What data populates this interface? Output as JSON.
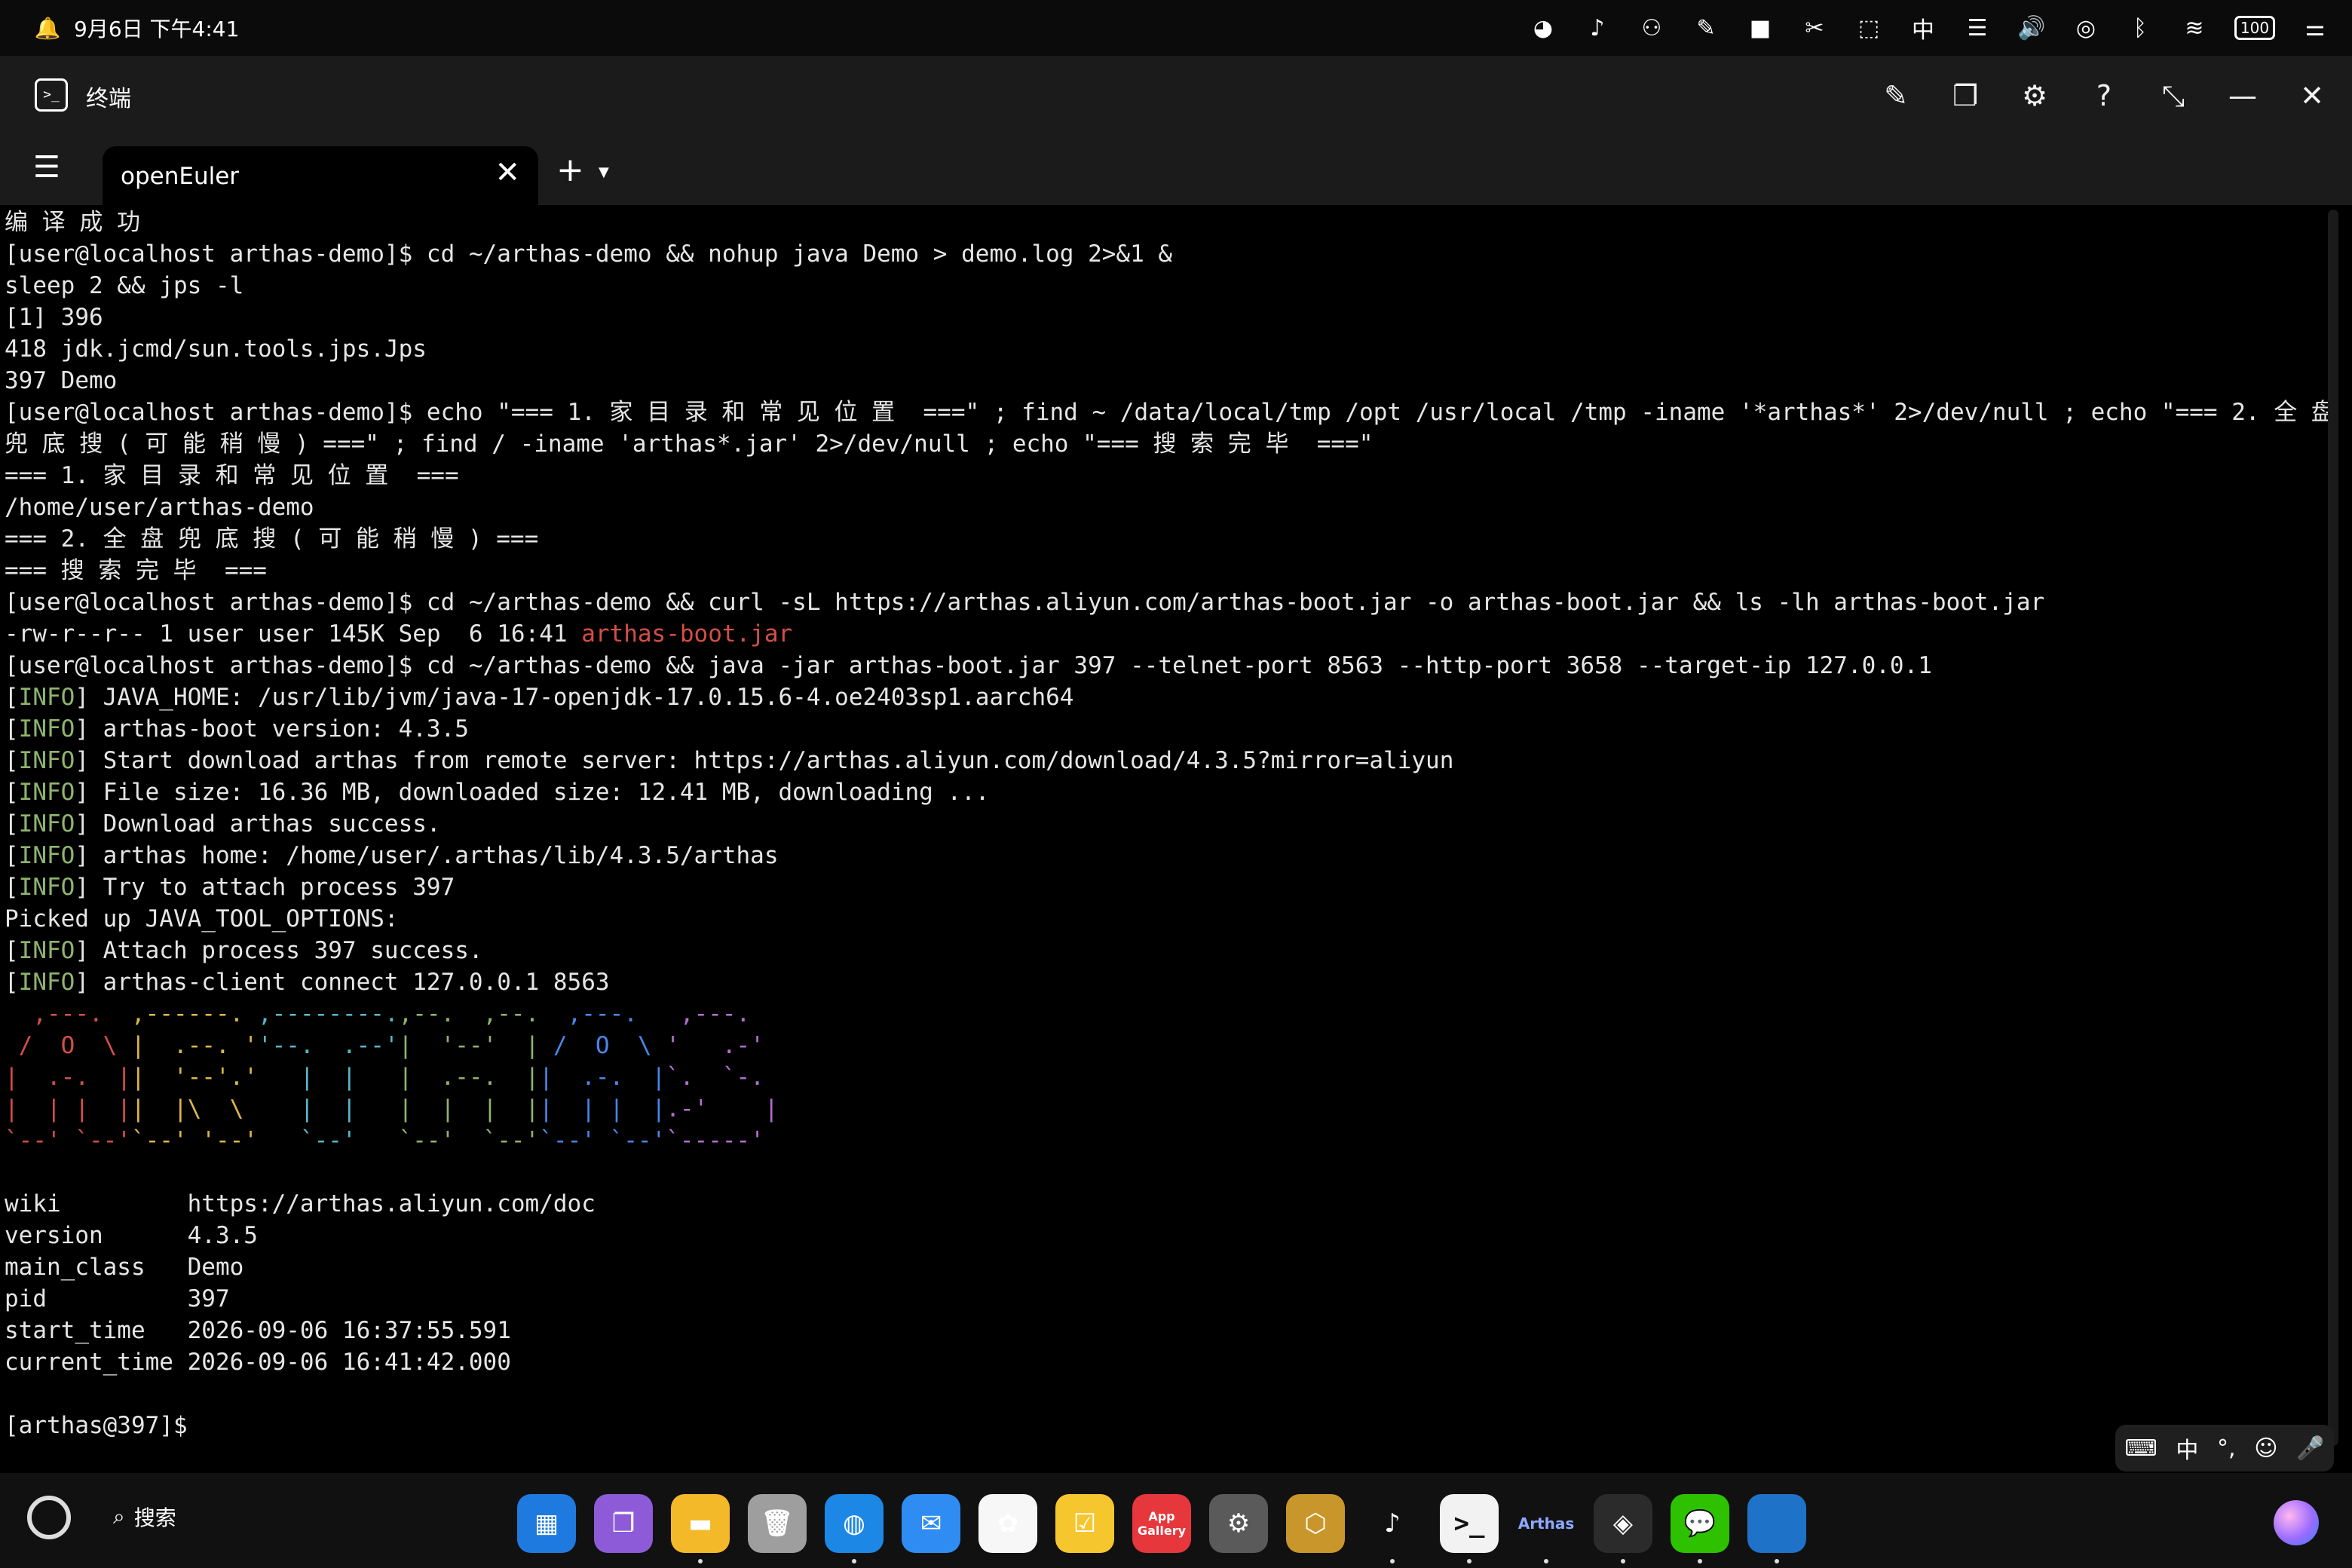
{
  "status_bar": {
    "datetime": "9月6日 下午4:41",
    "icons": [
      "bell-icon",
      "wechat-icon",
      "tiktok-icon",
      "connect-icon",
      "notes-icon",
      "video-icon",
      "scissors-icon",
      "screenshot-icon",
      "ime-icon",
      "subtitle-icon",
      "volume-icon",
      "nfc-icon",
      "bluetooth-icon",
      "wifi-icon",
      "battery-icon",
      "settings-sliders-icon"
    ],
    "battery": "100"
  },
  "window": {
    "title": "终端",
    "app_icon": ">_",
    "controls": [
      "edit-icon",
      "window-icon",
      "gear-icon",
      "help-icon",
      "shrink-icon",
      "minimize-icon",
      "close-icon"
    ]
  },
  "tabs": {
    "active": "openEuler",
    "close": "✕",
    "add": "+"
  },
  "terminal": {
    "lines": [
      {
        "segs": [
          {
            "t": "编 译 成 功"
          }
        ]
      },
      {
        "segs": [
          {
            "t": "[user@localhost arthas-demo]$ cd ~/arthas-demo && nohup java Demo > demo.log 2>&1 &"
          }
        ]
      },
      {
        "segs": [
          {
            "t": "sleep 2 && jps -l"
          }
        ]
      },
      {
        "segs": [
          {
            "t": "[1] 396"
          }
        ]
      },
      {
        "segs": [
          {
            "t": "418 jdk.jcmd/sun.tools.jps.Jps"
          }
        ]
      },
      {
        "segs": [
          {
            "t": "397 Demo"
          }
        ]
      },
      {
        "segs": [
          {
            "t": "[user@localhost arthas-demo]$ echo \"=== 1. 家 目 录 和 常 见 位 置  ===\" ; find ~ /data/local/tmp /opt /usr/local /tmp -iname '*arthas*' 2>/dev/null ; echo \"=== 2. 全 盘"
          }
        ]
      },
      {
        "segs": [
          {
            "t": "兜 底 搜 ( 可 能 稍 慢 ) ===\" ; find / -iname 'arthas*.jar' 2>/dev/null ; echo \"=== 搜 索 完 毕  ===\""
          }
        ]
      },
      {
        "segs": [
          {
            "t": "=== 1. 家 目 录 和 常 见 位 置  ==="
          }
        ]
      },
      {
        "segs": [
          {
            "t": "/home/user/arthas-demo"
          }
        ]
      },
      {
        "segs": [
          {
            "t": "=== 2. 全 盘 兜 底 搜 ( 可 能 稍 慢 ) ==="
          }
        ]
      },
      {
        "segs": [
          {
            "t": "=== 搜 索 完 毕  ==="
          }
        ]
      },
      {
        "segs": [
          {
            "t": "[user@localhost arthas-demo]$ cd ~/arthas-demo && curl -sL https://arthas.aliyun.com/arthas-boot.jar -o arthas-boot.jar && ls -lh arthas-boot.jar"
          }
        ]
      },
      {
        "segs": [
          {
            "t": "-rw-r--r-- 1 user user 145K Sep  6 16:41 "
          },
          {
            "t": "arthas-boot.jar",
            "c": "red"
          }
        ]
      },
      {
        "segs": [
          {
            "t": "[user@localhost arthas-demo]$ cd ~/arthas-demo && java -jar arthas-boot.jar 397 --telnet-port 8563 --http-port 3658 --target-ip 127.0.0.1"
          }
        ]
      },
      {
        "segs": [
          {
            "t": "["
          },
          {
            "t": "INFO",
            "c": "green"
          },
          {
            "t": "] JAVA_HOME: /usr/lib/jvm/java-17-openjdk-17.0.15.6-4.oe2403sp1.aarch64"
          }
        ]
      },
      {
        "segs": [
          {
            "t": "["
          },
          {
            "t": "INFO",
            "c": "green"
          },
          {
            "t": "] arthas-boot version: 4.3.5"
          }
        ]
      },
      {
        "segs": [
          {
            "t": "["
          },
          {
            "t": "INFO",
            "c": "green"
          },
          {
            "t": "] Start download arthas from remote server: https://arthas.aliyun.com/download/4.3.5?mirror=aliyun"
          }
        ]
      },
      {
        "segs": [
          {
            "t": "["
          },
          {
            "t": "INFO",
            "c": "green"
          },
          {
            "t": "] File size: 16.36 MB, downloaded size: 12.41 MB, downloading ..."
          }
        ]
      },
      {
        "segs": [
          {
            "t": "["
          },
          {
            "t": "INFO",
            "c": "green"
          },
          {
            "t": "] Download arthas success."
          }
        ]
      },
      {
        "segs": [
          {
            "t": "["
          },
          {
            "t": "INFO",
            "c": "green"
          },
          {
            "t": "] arthas home: /home/user/.arthas/lib/4.3.5/arthas"
          }
        ]
      },
      {
        "segs": [
          {
            "t": "["
          },
          {
            "t": "INFO",
            "c": "green"
          },
          {
            "t": "] Try to attach process 397"
          }
        ]
      },
      {
        "segs": [
          {
            "t": "Picked up JAVA_TOOL_OPTIONS:"
          }
        ]
      },
      {
        "segs": [
          {
            "t": "["
          },
          {
            "t": "INFO",
            "c": "green"
          },
          {
            "t": "] Attach process 397 success."
          }
        ]
      },
      {
        "segs": [
          {
            "t": "["
          },
          {
            "t": "INFO",
            "c": "green"
          },
          {
            "t": "] arthas-client connect 127.0.0.1 8563"
          }
        ]
      },
      {
        "segs": [
          {
            "t": "  ,---.  ",
            "c": "red"
          },
          {
            "t": ",------. ",
            "c": "yellow"
          },
          {
            "t": ",--------.",
            "c": "cyan"
          },
          {
            "t": ",--.  ,--. ",
            "c": "green"
          },
          {
            "t": " ,---.  ",
            "c": "blue"
          },
          {
            "t": " ,---.",
            "c": "purple"
          }
        ]
      },
      {
        "segs": [
          {
            "t": " /  O  \\ ",
            "c": "red"
          },
          {
            "t": "|  .--. '",
            "c": "yellow"
          },
          {
            "t": "'--.  .--'",
            "c": "cyan"
          },
          {
            "t": "|  '--'  |",
            "c": "green"
          },
          {
            "t": " /  O  \\ ",
            "c": "blue"
          },
          {
            "t": "'   .-'",
            "c": "purple"
          }
        ]
      },
      {
        "segs": [
          {
            "t": "|  .-.  |",
            "c": "red"
          },
          {
            "t": "|  '--'.'",
            "c": "yellow"
          },
          {
            "t": "   |  |   ",
            "c": "cyan"
          },
          {
            "t": "|  .--.  |",
            "c": "green"
          },
          {
            "t": "|  .-.  |",
            "c": "blue"
          },
          {
            "t": "`.  `-.",
            "c": "purple"
          }
        ]
      },
      {
        "segs": [
          {
            "t": "|  | |  |",
            "c": "red"
          },
          {
            "t": "|  |\\  \\ ",
            "c": "yellow"
          },
          {
            "t": "   |  |   ",
            "c": "cyan"
          },
          {
            "t": "|  |  |  |",
            "c": "green"
          },
          {
            "t": "|  | |  |",
            "c": "blue"
          },
          {
            "t": ".-'    |",
            "c": "purple"
          }
        ]
      },
      {
        "segs": [
          {
            "t": "`--' `--'",
            "c": "red"
          },
          {
            "t": "`--' '--'",
            "c": "yellow"
          },
          {
            "t": "   `--'   ",
            "c": "cyan"
          },
          {
            "t": "`--'  `--'",
            "c": "green"
          },
          {
            "t": "`--' `--'",
            "c": "blue"
          },
          {
            "t": "`-----'",
            "c": "purple"
          }
        ]
      },
      {
        "segs": [
          {
            "t": ""
          }
        ]
      },
      {
        "segs": [
          {
            "t": "wiki         https://arthas.aliyun.com/doc"
          }
        ]
      },
      {
        "segs": [
          {
            "t": "version      4.3.5"
          }
        ]
      },
      {
        "segs": [
          {
            "t": "main_class   Demo"
          }
        ]
      },
      {
        "segs": [
          {
            "t": "pid          397"
          }
        ]
      },
      {
        "segs": [
          {
            "t": "start_time   2026-09-06 16:37:55.591"
          }
        ]
      },
      {
        "segs": [
          {
            "t": "current_time 2026-09-06 16:41:42.000"
          }
        ]
      },
      {
        "segs": [
          {
            "t": ""
          }
        ]
      },
      {
        "segs": [
          {
            "t": "[arthas@397]$ "
          }
        ]
      }
    ]
  },
  "ime_bar": {
    "items": [
      "keyboard-icon",
      "中",
      "°,",
      "emoji-icon",
      "mic-icon"
    ]
  },
  "dock": {
    "search_label": "搜索",
    "apps": [
      {
        "name": "app-grid",
        "color": "#1f7ae0",
        "glyph": "▦",
        "dot": false
      },
      {
        "name": "multitask",
        "color": "#8e5bd8",
        "glyph": "❐",
        "dot": false
      },
      {
        "name": "files",
        "color": "#f4b928",
        "glyph": "▬",
        "dot": true
      },
      {
        "name": "trash",
        "color": "#9e9e9e",
        "glyph": "🗑",
        "dot": false
      },
      {
        "name": "browser",
        "color": "#1d87e6",
        "glyph": "◍",
        "dot": true
      },
      {
        "name": "mail",
        "color": "#2f8cf2",
        "glyph": "✉",
        "dot": false
      },
      {
        "name": "gallery",
        "color": "#f7f7f7",
        "glyph": "✿",
        "dot": false
      },
      {
        "name": "notes",
        "color": "#f6c62e",
        "glyph": "☑",
        "dot": false
      },
      {
        "name": "appgallery",
        "color": "#e5373c",
        "glyph": "App Gallery",
        "dot": false
      },
      {
        "name": "settings",
        "color": "#5a5a5a",
        "glyph": "⚙",
        "dot": false
      },
      {
        "name": "security",
        "color": "#c9962b",
        "glyph": "⬡",
        "dot": false
      },
      {
        "name": "tiktok",
        "color": "#111111",
        "glyph": "♪",
        "dot": true
      },
      {
        "name": "terminal",
        "color": "#f2f2f2",
        "glyph": ">_",
        "dot": true
      },
      {
        "name": "arthas",
        "color": "#111111",
        "glyph": "Arthas",
        "dot": true
      },
      {
        "name": "layers",
        "color": "#2b2b2b",
        "glyph": "◈",
        "dot": true
      },
      {
        "name": "wechat",
        "color": "#2dc100",
        "glyph": "💬",
        "dot": true
      },
      {
        "name": "blue-app",
        "color": "#1e73c8",
        "glyph": "",
        "dot": true
      }
    ]
  }
}
